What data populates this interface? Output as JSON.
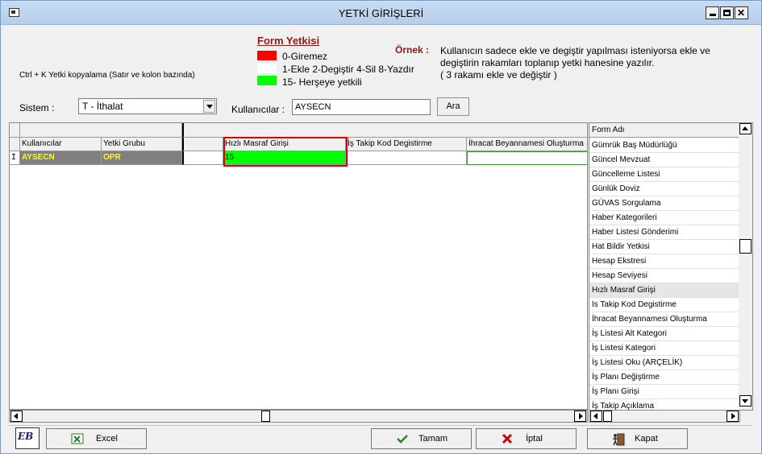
{
  "window": {
    "title": "YETKİ GİRİŞLERİ"
  },
  "hint": "Ctrl + K Yetki kopyalama (Satır ve kolon bazında)",
  "form_yetkisi": {
    "title": "Form Yetkisi",
    "legend": [
      "0-Giremez",
      "1-Ekle  2-Degiştir  4-Sil  8-Yazdır",
      "15- Herşeye yetkili"
    ],
    "colors": {
      "giremez": "#ff0000",
      "ekle": "#ffffff",
      "hersey": "#00ff00"
    }
  },
  "ornek": {
    "label": "Örnek :",
    "lines": [
      "Kullanıcın sadece ekle ve degiştir yapılması isteniyorsa  ekle ve",
      "degiştirin rakamları toplanıp yetki hanesine yazılır.",
      " ( 3 rakamı ekle ve değiştir )"
    ]
  },
  "filters": {
    "sistem_label": "Sistem :",
    "sistem_value": "T - İthalat",
    "kullanicilar_label": "Kullanıcılar :",
    "kullanicilar_value": "AYSECN",
    "ara_button": "Ara"
  },
  "grid": {
    "columns": [
      "Kullanıcılar",
      "Yetki Grubu",
      "Hızlı Masraf Girişi",
      "İş Takip Kod Degistirme",
      "İhracat Beyannamesi Oluşturma"
    ],
    "row_indicator": "I",
    "row": {
      "user": "AYSECN",
      "group": "OPR",
      "hizli_masraf": "15",
      "is_takip": "",
      "ihracat": ""
    }
  },
  "form_list": {
    "header": "Form Adı",
    "items": [
      "Gümrük Baş Müdürlüğü",
      "Güncel Mevzuat",
      "Güncelleme Listesi",
      "Günlük Doviz",
      "GÜVAS Sorgulama",
      "Haber Kategorileri",
      "Haber Listesi Gönderimi",
      "Hat Bildir Yetkisi",
      "Hesap Ekstresi",
      "Hesap Seviyesi",
      "Hızlı Masraf Girişi",
      "Is Takip Kod Degistirme",
      "İhracat Beyannamesi Oluşturma",
      "İş Listesi Alt Kategori",
      "İş Listesi Kategori",
      "İş Listesi Oku (ARÇELİK)",
      "İş Planı Değiştirme",
      "İş Planı Girişi",
      "İş Takip Açıklama"
    ],
    "selected": "Hızlı Masraf Girişi"
  },
  "buttons": {
    "logo": "EB",
    "excel": "Excel",
    "tamam": "Tamam",
    "iptal": "İptal",
    "kapat": "Kapat"
  }
}
